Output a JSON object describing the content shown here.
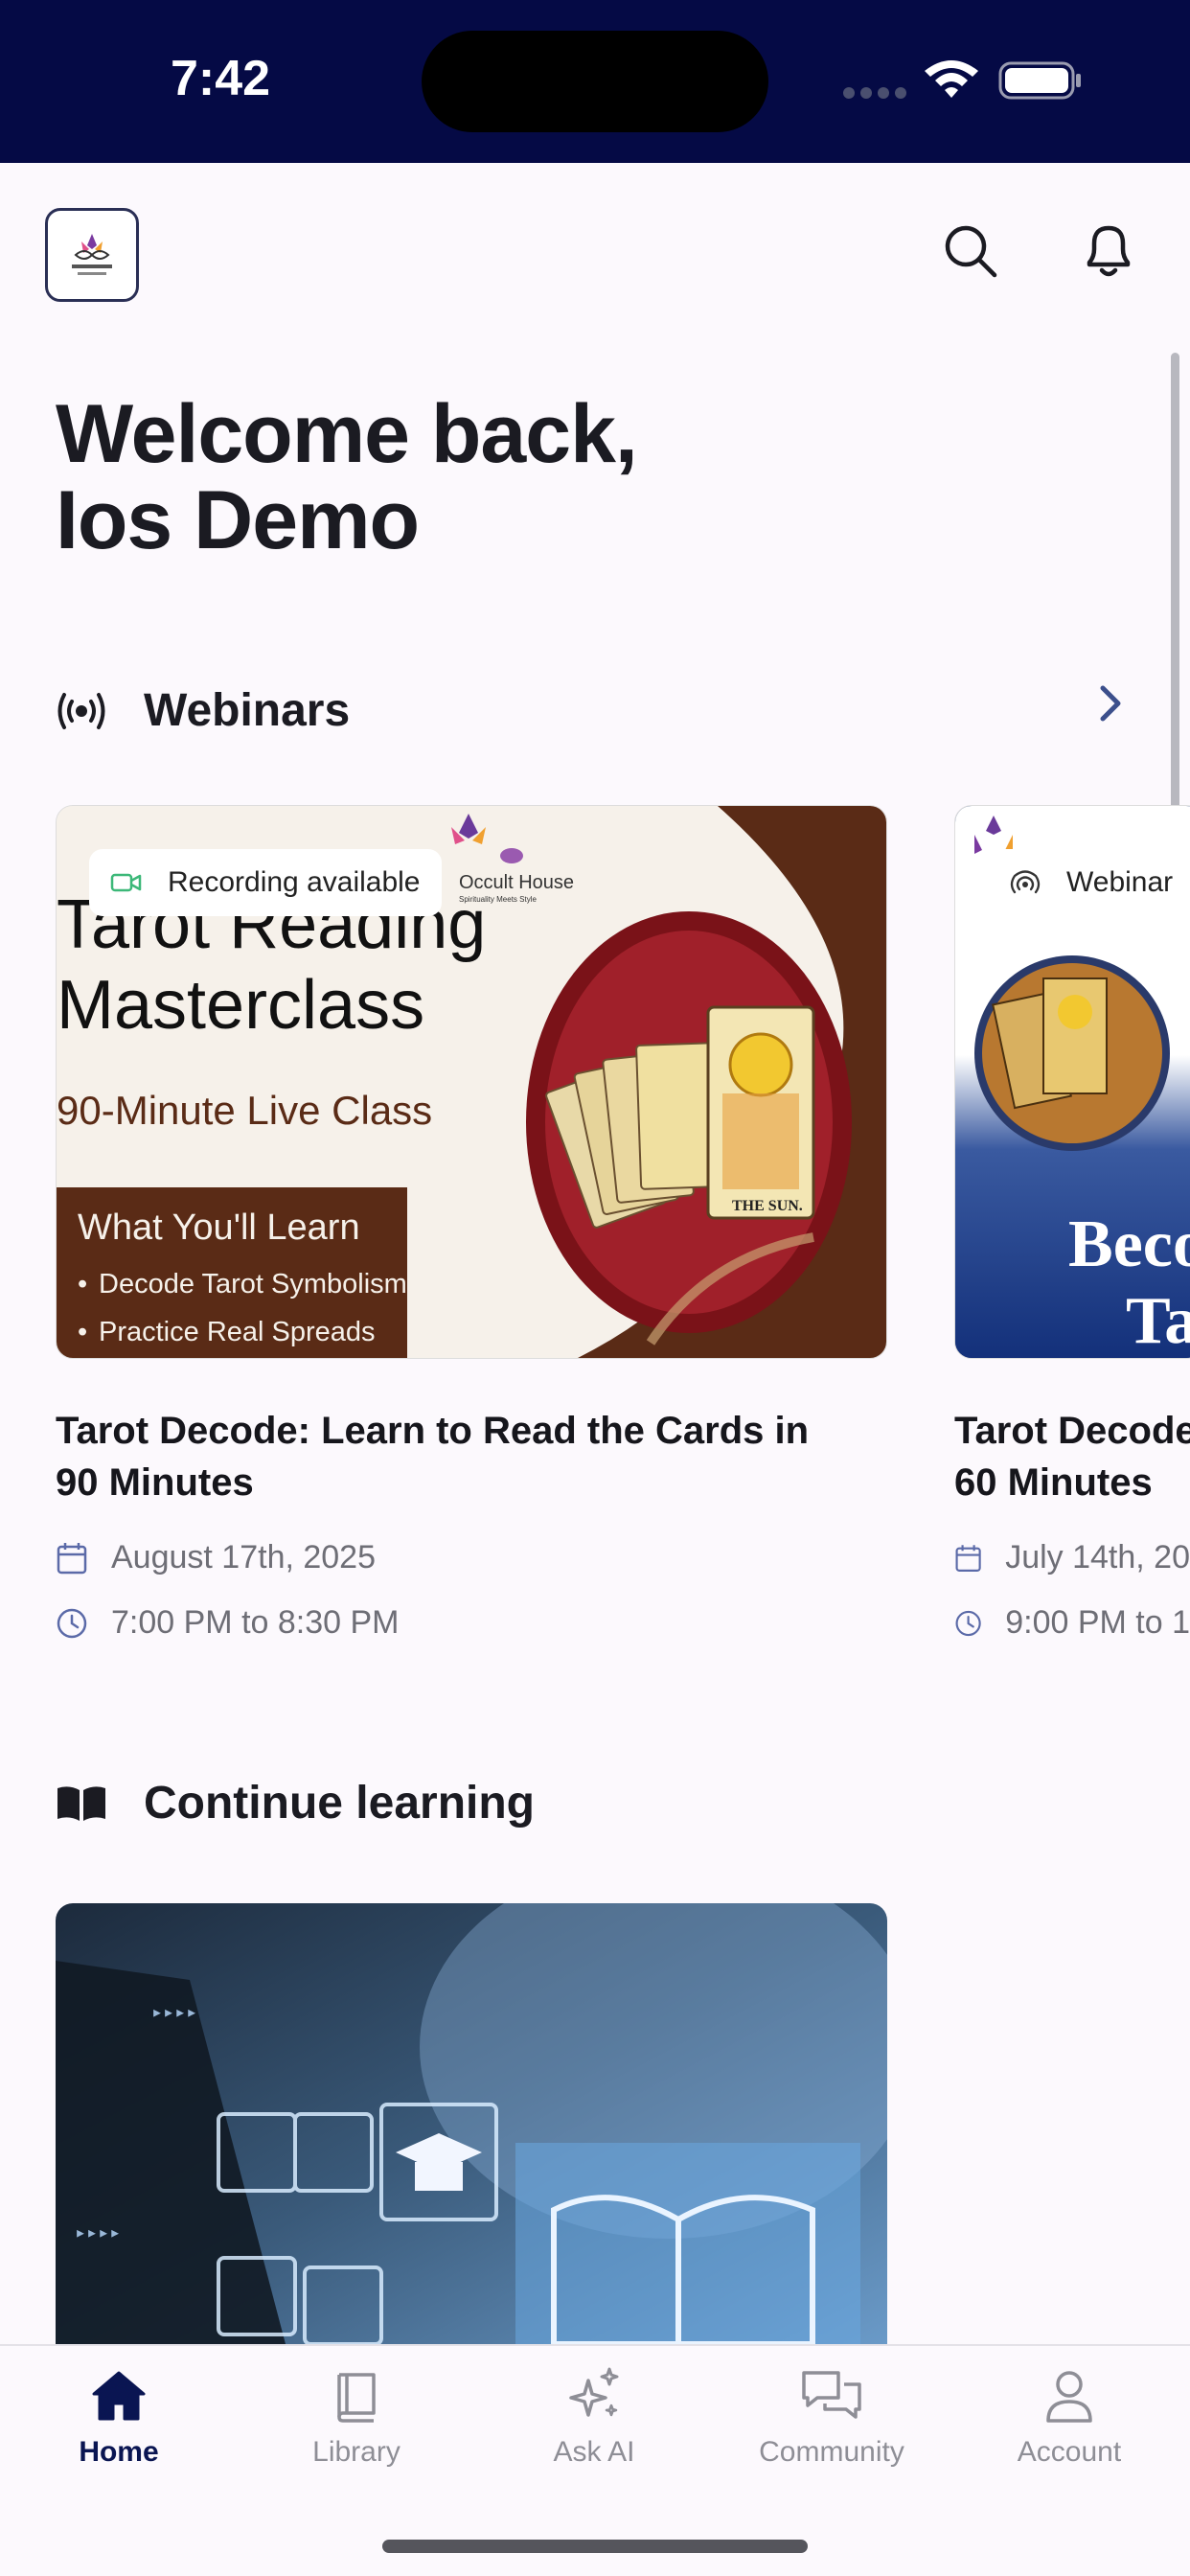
{
  "status_bar": {
    "time": "7:42"
  },
  "header": {
    "logo_alt": "Occult House"
  },
  "welcome": {
    "line1": "Welcome back,",
    "line2": "Ios Demo"
  },
  "webinars_section": {
    "title": "Webinars"
  },
  "webinar_cards": [
    {
      "badge": "Recording available",
      "banner": {
        "brand": "Occult House",
        "tagline": "Spirituality Meets Style",
        "headline1": "Tarot Reading",
        "headline2": "Masterclass",
        "subheadline": "90-Minute Live Class",
        "learn_title": "What You'll Learn",
        "learn_items": [
          "Decode Tarot Symbolism",
          "Practice Real Spreads"
        ],
        "card_label": "THE SUN."
      },
      "title_line1": "Tarot Decode: Learn to Read the Cards in",
      "title_line2": "90 Minutes",
      "date": "August 17th, 2025",
      "time": "7:00 PM to 8:30 PM"
    },
    {
      "badge": "Webinar",
      "banner": {
        "headline1": "Beco",
        "headline2": "Ta"
      },
      "title_line1": "Tarot Decode",
      "title_line2": "60 Minutes",
      "date": "July 14th, 20",
      "time": "9:00 PM to 1"
    }
  ],
  "continue_section": {
    "title": "Continue learning"
  },
  "colors": {
    "status_bar_bg": "#050a45",
    "page_bg": "#fcf9fd",
    "active_tab": "#0a1552",
    "inactive_tab": "#8e8e96",
    "banner_brown": "#5a2b16"
  },
  "tab_bar": {
    "tabs": [
      {
        "label": "Home",
        "icon": "home-icon",
        "active": true
      },
      {
        "label": "Library",
        "icon": "book-icon",
        "active": false
      },
      {
        "label": "Ask AI",
        "icon": "sparkle-icon",
        "active": false
      },
      {
        "label": "Community",
        "icon": "chat-icon",
        "active": false
      },
      {
        "label": "Account",
        "icon": "person-icon",
        "active": false
      }
    ]
  }
}
